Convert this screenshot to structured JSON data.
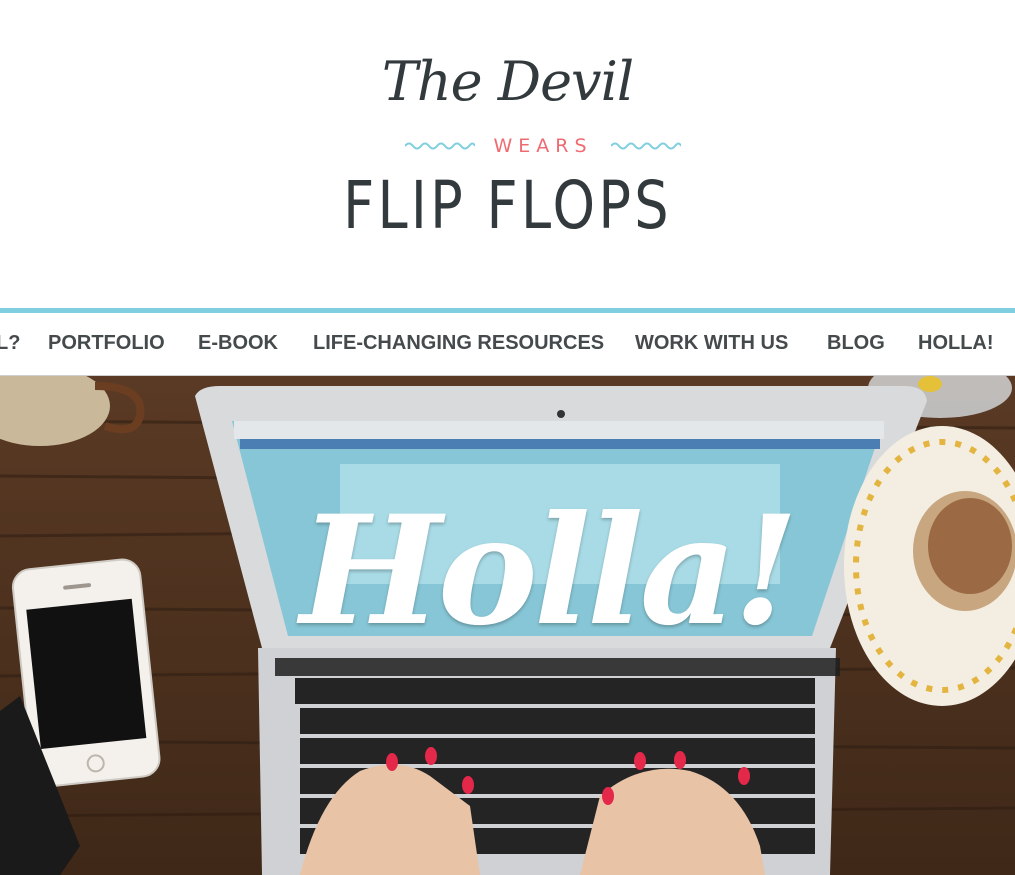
{
  "logo": {
    "line1": "The Devil",
    "line2": "WEARS",
    "line3": "FLIP FLOPS",
    "dark_color": "#333a3d",
    "accent_color": "#ef6b72",
    "wave_color": "#7fcfe0"
  },
  "nav": {
    "items": [
      {
        "label": "L?"
      },
      {
        "label": "PORTFOLIO"
      },
      {
        "label": "E-BOOK"
      },
      {
        "label": "LIFE-CHANGING RESOURCES"
      },
      {
        "label": "WORK WITH US"
      },
      {
        "label": "BLOG"
      },
      {
        "label": "HOLLA!"
      }
    ],
    "accent_color": "#7fcfe0"
  },
  "hero": {
    "title": "Holla!"
  }
}
